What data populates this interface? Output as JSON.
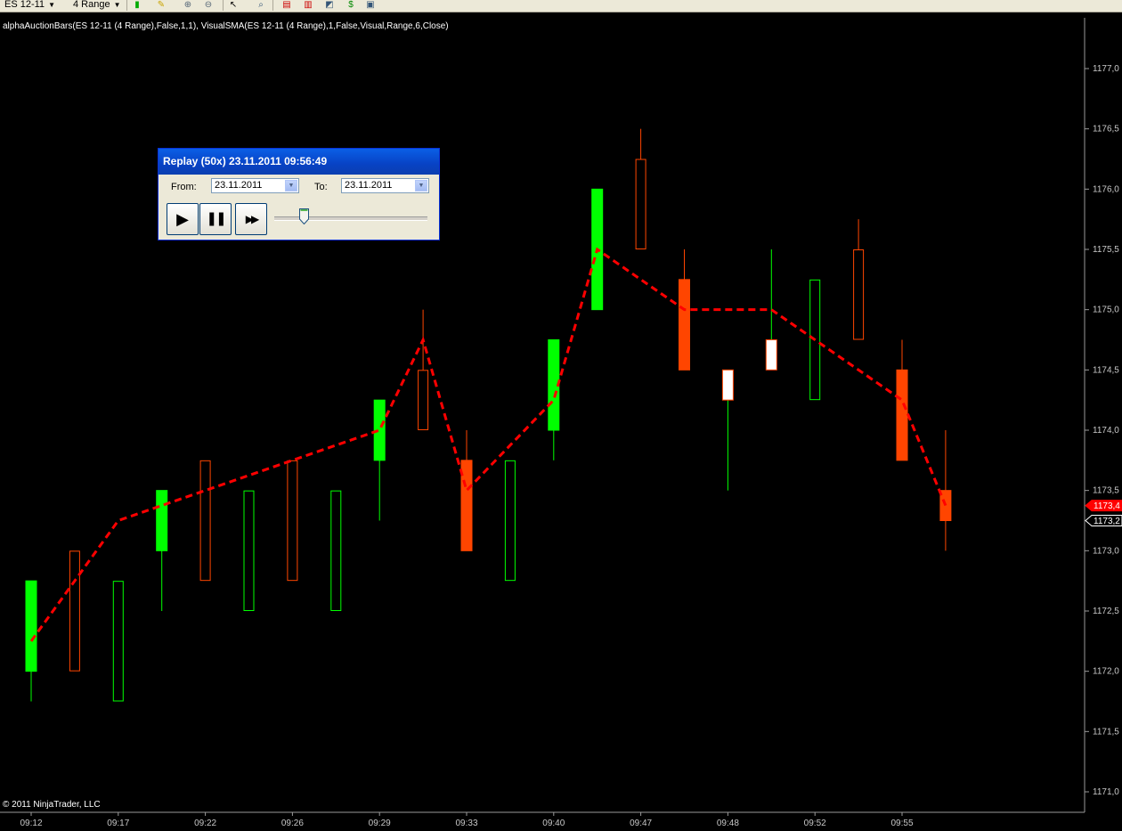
{
  "toolbar": {
    "instrument": "ES 12-11",
    "period": "4 Range"
  },
  "indicator_label": "alphaAuctionBars(ES 12-11 (4 Range),False,1,1), VisualSMA(ES 12-11 (4 Range),1,False,Visual,Range,6,Close)",
  "copyright": "© 2011 NinjaTrader, LLC",
  "replay": {
    "title": "Replay (50x) 23.11.2011 09:56:49",
    "from_label": "From:",
    "from_value": "23.11.2011",
    "to_label": "To:",
    "to_value": "23.11.2011",
    "play_glyph": "▶",
    "pause_glyph": "❚❚",
    "forward_glyph": "▶▶",
    "speed_level": 0.2
  },
  "colors": {
    "up_bar": "#00ff00",
    "down_bar": "#ff4500",
    "neutral_bar": "#ffffff",
    "sma": "#ff0000",
    "last_price_bg": "#ff0000"
  },
  "chart_data": {
    "type": "candlestick",
    "ylim": [
      1170.875,
      1177.25
    ],
    "y_ticks": [
      1171.0,
      1171.5,
      1172.0,
      1172.5,
      1173.0,
      1173.5,
      1174.0,
      1174.5,
      1175.0,
      1175.5,
      1176.0,
      1176.5,
      1177.0
    ],
    "y_tick_labels": [
      "1171,0",
      "1171,5",
      "1172,0",
      "1172,5",
      "1173,0",
      "1173,5",
      "1174,0",
      "1174,5",
      "1175,0",
      "1175,5",
      "1176,0",
      "1176,5",
      "1177,0"
    ],
    "x_labels": [
      {
        "bar": 0,
        "label": "09:12"
      },
      {
        "bar": 2,
        "label": "09:17"
      },
      {
        "bar": 4,
        "label": "09:22"
      },
      {
        "bar": 6,
        "label": "09:26"
      },
      {
        "bar": 8,
        "label": "09:29"
      },
      {
        "bar": 10,
        "label": "09:33"
      },
      {
        "bar": 12,
        "label": "09:40"
      },
      {
        "bar": 14,
        "label": "09:47"
      },
      {
        "bar": 16,
        "label": "09:48"
      },
      {
        "bar": 18,
        "label": "09:52"
      },
      {
        "bar": 20,
        "label": "09:55"
      }
    ],
    "bars": [
      {
        "open": 1172.0,
        "close": 1172.75,
        "high": 1172.75,
        "low": 1171.75,
        "kind": "up",
        "filled": true
      },
      {
        "open": 1173.0,
        "close": 1172.0,
        "high": 1173.0,
        "low": 1172.0,
        "kind": "down",
        "filled": false
      },
      {
        "open": 1171.75,
        "close": 1172.75,
        "high": 1172.75,
        "low": 1171.75,
        "kind": "up",
        "filled": false
      },
      {
        "open": 1173.0,
        "close": 1173.5,
        "high": 1173.5,
        "low": 1172.5,
        "kind": "up",
        "filled": true
      },
      {
        "open": 1173.75,
        "close": 1172.75,
        "high": 1173.75,
        "low": 1172.75,
        "kind": "down",
        "filled": false
      },
      {
        "open": 1172.5,
        "close": 1173.5,
        "high": 1173.5,
        "low": 1172.5,
        "kind": "up",
        "filled": false
      },
      {
        "open": 1173.75,
        "close": 1172.75,
        "high": 1173.75,
        "low": 1172.75,
        "kind": "down",
        "filled": false
      },
      {
        "open": 1172.5,
        "close": 1173.5,
        "high": 1173.5,
        "low": 1172.5,
        "kind": "up",
        "filled": false
      },
      {
        "open": 1173.75,
        "close": 1174.25,
        "high": 1174.25,
        "low": 1173.25,
        "kind": "up",
        "filled": true
      },
      {
        "open": 1174.5,
        "close": 1174.0,
        "high": 1175.0,
        "low": 1174.0,
        "kind": "down",
        "filled": false
      },
      {
        "open": 1173.75,
        "close": 1173.0,
        "high": 1174.0,
        "low": 1173.0,
        "kind": "down",
        "filled": true
      },
      {
        "open": 1172.75,
        "close": 1173.75,
        "high": 1173.75,
        "low": 1172.75,
        "kind": "up",
        "filled": false
      },
      {
        "open": 1174.0,
        "close": 1174.75,
        "high": 1174.75,
        "low": 1173.75,
        "kind": "up",
        "filled": true
      },
      {
        "open": 1175.0,
        "close": 1176.0,
        "high": 1176.0,
        "low": 1175.0,
        "kind": "up",
        "filled": true
      },
      {
        "open": 1176.25,
        "close": 1175.5,
        "high": 1176.5,
        "low": 1175.5,
        "kind": "down",
        "filled": false
      },
      {
        "open": 1175.25,
        "close": 1174.5,
        "high": 1175.5,
        "low": 1174.5,
        "kind": "down",
        "filled": true
      },
      {
        "open": 1174.25,
        "close": 1174.5,
        "high": 1174.5,
        "low": 1173.5,
        "kind": "neutral",
        "filled": true
      },
      {
        "open": 1174.5,
        "close": 1174.75,
        "high": 1175.5,
        "low": 1174.5,
        "kind": "neutral",
        "filled": true
      },
      {
        "open": 1175.25,
        "close": 1174.25,
        "high": 1175.25,
        "low": 1174.25,
        "kind": "up",
        "filled": false
      },
      {
        "open": 1175.5,
        "close": 1174.75,
        "high": 1175.75,
        "low": 1174.75,
        "kind": "down",
        "filled": false
      },
      {
        "open": 1174.5,
        "close": 1173.75,
        "high": 1174.75,
        "low": 1173.75,
        "kind": "down",
        "filled": true
      },
      {
        "open": 1173.5,
        "close": 1173.25,
        "high": 1174.0,
        "low": 1173.0,
        "kind": "down",
        "filled": true
      }
    ],
    "sma": [
      1172.25,
      null,
      1173.25,
      null,
      1173.5,
      null,
      1173.75,
      null,
      1174.0,
      1174.75,
      1173.5,
      null,
      1174.25,
      1175.5,
      null,
      1175.0,
      null,
      1175.0,
      null,
      null,
      1174.25,
      1173.375
    ],
    "last_price_labels": [
      {
        "text": "1173,4",
        "value": 1173.375,
        "style": "filled"
      },
      {
        "text": "1173,2",
        "value": 1173.25,
        "style": "outline"
      }
    ]
  }
}
